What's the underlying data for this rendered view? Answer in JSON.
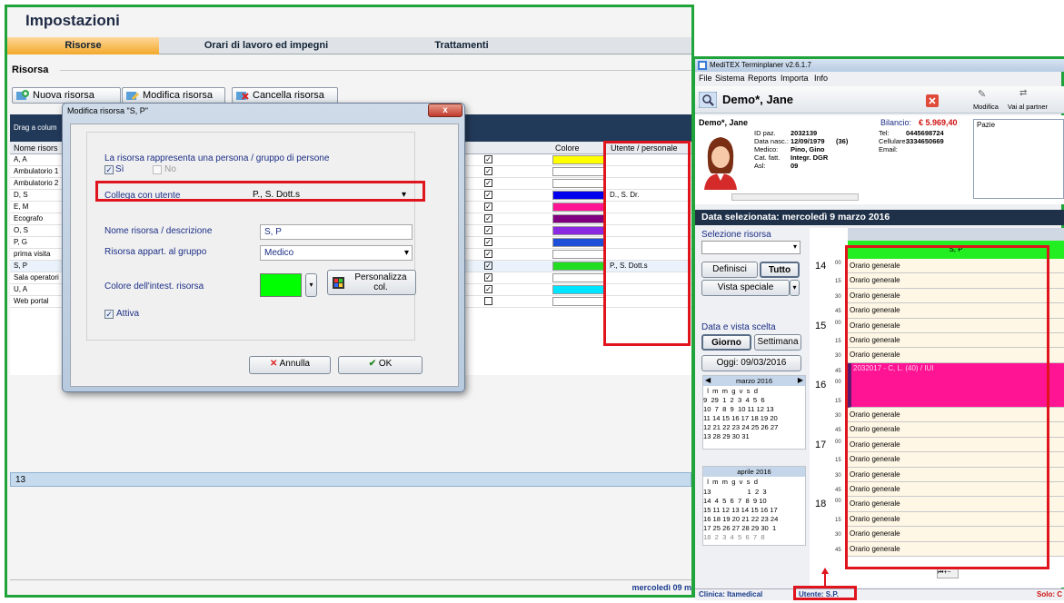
{
  "impostazioni": {
    "title": "Impostazioni",
    "tabs": [
      "Risorse",
      "Orari di lavoro ed impegni",
      "Trattamenti"
    ],
    "section_label": "Risorsa",
    "buttons": {
      "nuova": "Nuova risorsa",
      "modifica": "Modifica risorsa",
      "cancella": "Cancella risorsa"
    },
    "drag_hint": "Drag a colum",
    "columns": {
      "nome": "Nome risors",
      "colore": "Colore",
      "utente": "Utente / personale"
    },
    "rows": [
      {
        "name": "A, A",
        "checked": true,
        "color": "#ffff00",
        "user": ""
      },
      {
        "name": "Ambulatorio 1",
        "checked": true,
        "color": "#ffffff",
        "user": ""
      },
      {
        "name": "Ambulatorio 2",
        "checked": true,
        "color": "#ffffff",
        "user": ""
      },
      {
        "name": "D, S",
        "checked": true,
        "color": "#0000ee",
        "user": "D., S. Dr."
      },
      {
        "name": "E, M",
        "checked": true,
        "color": "#ff1493",
        "user": ""
      },
      {
        "name": "Ecografo",
        "checked": true,
        "color": "#800080",
        "user": ""
      },
      {
        "name": "O, S",
        "checked": true,
        "color": "#8a2be2",
        "user": ""
      },
      {
        "name": "P, G",
        "checked": true,
        "color": "#1e4fd8",
        "user": ""
      },
      {
        "name": "prima visita",
        "checked": true,
        "color": "#ffffff",
        "user": ""
      },
      {
        "name": "S, P",
        "checked": true,
        "color": "#22dd22",
        "user": "P., S. Dott.s"
      },
      {
        "name": "Sala operatori",
        "checked": true,
        "color": "#ffffff",
        "user": ""
      },
      {
        "name": "U, A",
        "checked": true,
        "color": "#00e5ff",
        "user": ""
      },
      {
        "name": "Web portal",
        "checked": false,
        "color": "#ffffff",
        "user": ""
      }
    ],
    "count": "13",
    "footer_date": "mercoledì 09 m"
  },
  "dialog": {
    "title": "Modifica risorsa \"S, P\"",
    "close": "x",
    "persona_question": "La risorsa rappresenta una persona / gruppo di persone",
    "si": "Sì",
    "no": "No",
    "collega_label": "Collega con utente",
    "collega_value": "P., S. Dott.s",
    "nome_label": "Nome risorsa / descrizione",
    "nome_value": "S, P",
    "gruppo_label": "Risorsa appart. al gruppo",
    "gruppo_value": "Medico",
    "colore_label": "Colore dell'intest. risorsa",
    "colore_value": "#00ff00",
    "personalizza_line1": "Personalizza",
    "personalizza_line2": "col.",
    "attiva": "Attiva",
    "annulla": "Annulla",
    "ok": "OK"
  },
  "meditex": {
    "title": "MediTEX Terminplaner  v2.6.1.7",
    "menu": [
      "File",
      "Sistema",
      "Reports",
      "Importa",
      "Info"
    ],
    "patient_name": "Demo*, Jane",
    "toolbar": {
      "modifica": "Modifica",
      "partner": "Vai al partner"
    },
    "patient": {
      "name": "Demo*, Jane",
      "bilancio_label": "Bilancio:",
      "bilancio": "€ 5.969,40",
      "id_label": "ID paz.",
      "id": "2032139",
      "nasc_label": "Data nasc.:",
      "nasc": "12/09/1979",
      "age": "(36)",
      "medico_label": "Medico:",
      "medico": "Pino, Gino",
      "catfatt_label": "Cat. fatt.",
      "catfatt": "Integr. DGR",
      "asl_label": "Asl:",
      "asl": "09",
      "tel_label": "Tel:",
      "tel": "0445698724",
      "cell_label": "Cellulare:",
      "cell": "3334650669",
      "email_label": "Email:",
      "pazie": "Pazie"
    },
    "selected_date": "Data selezionata:  mercoledì 9 marzo 2016",
    "selezione_risorsa": "Selezione risorsa",
    "definisci": "Definisci",
    "tutto": "Tutto",
    "vista_speciale": "Vista speciale",
    "data_vista": "Data e vista scelta",
    "giorno": "Giorno",
    "settimana": "Settimana",
    "oggi": "Oggi: 09/03/2016",
    "cal1": {
      "month": "marzo 2016",
      "head": "  l  m  m  g  v  s  d",
      "weeks": [
        "9  29  1  2  3  4  5  6",
        "10  7  8  9  10 11 12 13",
        "11 14 15 16 17 18 19 20",
        "12 21 22 23 24 25 26 27",
        "13 28 29 30 31"
      ]
    },
    "cal2": {
      "month": "aprile 2016",
      "head": "  l  m  m  g  v  s  d",
      "weeks": [
        "13                   1  2  3",
        "14  4  5  6  7  8  9 10",
        "15 11 12 13 14 15 16 17",
        "16 18 19 20 21 22 23 24",
        "17 25 26 27 28 29 30  1",
        "18  2  3  4  5  6  7  8"
      ]
    },
    "column_header": "S, P",
    "slot_label": "Orario generale",
    "appointment": "2032017 - C, L. (40) / IUI",
    "hours": [
      "14",
      "15",
      "16",
      "17",
      "18"
    ],
    "minutes": [
      "00",
      "15",
      "30",
      "45"
    ],
    "status": {
      "clinica": "Clinica: Itamedical",
      "utente": "Utente: S.P.",
      "solo": "Solo: C"
    }
  }
}
